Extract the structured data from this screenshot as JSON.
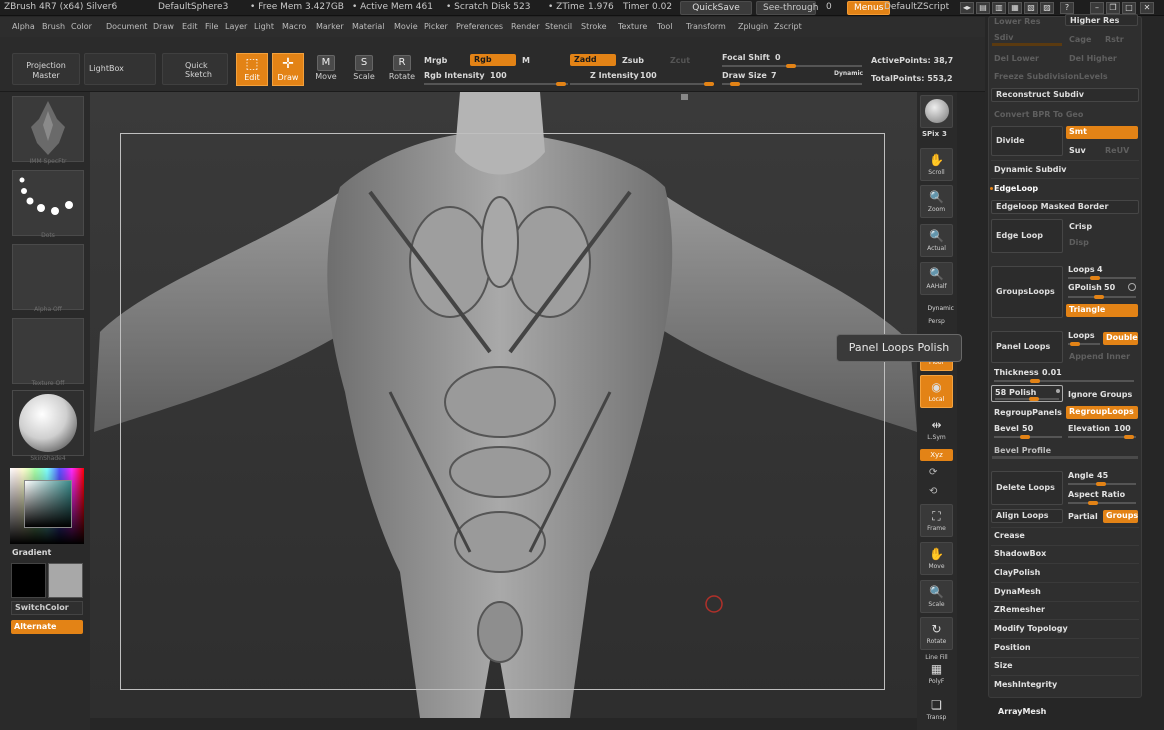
{
  "titlebar": {
    "app": "ZBrush 4R7 (x64) Silver6",
    "document": "DefaultSphere3",
    "free_mem": "• Free Mem 3.427GB",
    "active_mem": "• Active Mem 461",
    "scratch": "• Scratch Disk 523",
    "ztime": "• ZTime",
    "ztime_val": "1.976",
    "timer": "Timer",
    "timer_val": "0.02",
    "quicksave": "QuickSave",
    "see_through": "See-through",
    "see_through_val": "0",
    "menus": "Menus",
    "script": "DefaultZScript"
  },
  "menubar": [
    "Alpha",
    "Brush",
    "Color",
    "Document",
    "Draw",
    "Edit",
    "File",
    "Layer",
    "Light",
    "Macro",
    "Marker",
    "Material",
    "Movie",
    "Picker",
    "Preferences",
    "Render",
    "Stencil",
    "Stroke",
    "Texture",
    "Tool",
    "Transform",
    "Zplugin",
    "Zscript"
  ],
  "shelf": {
    "projection_master": "Projection Master",
    "lightbox": "LightBox",
    "quick_sketch": "Quick Sketch",
    "edit": "Edit",
    "draw": "Draw",
    "move": "Move",
    "scale": "Scale",
    "rotate": "Rotate",
    "mrgb": "Mrgb",
    "rgb": "Rgb",
    "m": "M",
    "rgb_intensity_label": "Rgb Intensity",
    "rgb_intensity_val": "100",
    "zadd": "Zadd",
    "zsub": "Zsub",
    "zcut": "Zcut",
    "z_intensity_label": "Z Intensity",
    "z_intensity_val": "100",
    "focal_shift_label": "Focal Shift",
    "focal_shift_val": "0",
    "draw_size_label": "Draw Size",
    "draw_size_val": "7",
    "dynamic": "Dynamic",
    "active_points": "ActivePoints: 38,7",
    "total_points": "TotalPoints: 553,2"
  },
  "left_tray": {
    "brush_label": "IMM SpecFtr",
    "stroke_label": "Dots",
    "alpha_label": "Alpha Off",
    "texture_label": "Texture Off",
    "material_label": "SkinShade4",
    "gradient": "Gradient",
    "switch_color": "SwitchColor",
    "alternate": "Alternate"
  },
  "right_strip": {
    "bpr": "BPR",
    "spix_label": "SPix",
    "spix_val": "3",
    "scroll": "Scroll",
    "zoom": "Zoom",
    "actual": "Actual",
    "aahalf": "AAHalf",
    "persp": "Persp",
    "dynamic": "Dynamic",
    "floor": "Floor",
    "local": "Local",
    "lsym": "L.Sym",
    "xyz": "Xyz",
    "frame": "Frame",
    "move": "Move",
    "scale": "Scale",
    "rotate": "Rotate",
    "line_fill": "Line Fill",
    "polyf": "PolyF",
    "transp": "Transp"
  },
  "geometry_panel": {
    "lower_res": "Lower Res",
    "higher_res": "Higher Res",
    "sdiv": "Sdiv",
    "cage": "Cage",
    "rstr": "Rstr",
    "del_lower": "Del Lower",
    "del_higher": "Del Higher",
    "freeze_subdiv": "Freeze SubdivisionLevels",
    "reconstruct_subdiv": "Reconstruct Subdiv",
    "convert_bpr": "Convert BPR To Geo",
    "divide": "Divide",
    "smt": "Smt",
    "suv": "Suv",
    "reuv": "ReUV",
    "dynamic_subdiv": "Dynamic Subdiv",
    "edgeloop": "EdgeLoop",
    "edgeloop_masked": "Edgeloop Masked Border",
    "edge_loop": "Edge Loop",
    "crisp": "Crisp",
    "disp": "Disp",
    "groups_loops": "GroupsLoops",
    "loops_label": "Loops",
    "loops_val": "4",
    "gpolish_label": "GPolish",
    "gpolish_val": "50",
    "triangle": "Triangle",
    "panel_loops": "Panel Loops",
    "panel_loops_loops": "Loops",
    "double": "Double",
    "append_inner": "Append Inner",
    "thickness_label": "Thickness",
    "thickness_val": "0.01",
    "polish_label": "Polish",
    "polish_val": "58",
    "ignore_groups": "Ignore Groups",
    "regroup_panels": "RegroupPanels",
    "regroup_loops": "RegroupLoops",
    "bevel_label": "Bevel",
    "bevel_val": "50",
    "elevation_label": "Elevation",
    "elevation_val": "100",
    "bevel_profile": "Bevel Profile",
    "angle_label": "Angle",
    "angle_val": "45",
    "aspect_ratio": "Aspect Ratio",
    "delete_loops": "Delete Loops",
    "align_loops": "Align Loops",
    "partial": "Partial",
    "groups": "Groups",
    "crease": "Crease",
    "shadowbox": "ShadowBox",
    "claypolish": "ClayPolish",
    "dynamesh": "DynaMesh",
    "zremesher": "ZRemesher",
    "modify_topology": "Modify Topology",
    "position": "Position",
    "size": "Size",
    "meshintegrity": "MeshIntegrity",
    "arraymesh": "ArrayMesh"
  },
  "tooltip": "Panel Loops Polish",
  "colors": {
    "accent": "#e38316",
    "panel": "#2f2f2f",
    "canvas": "#353535"
  }
}
